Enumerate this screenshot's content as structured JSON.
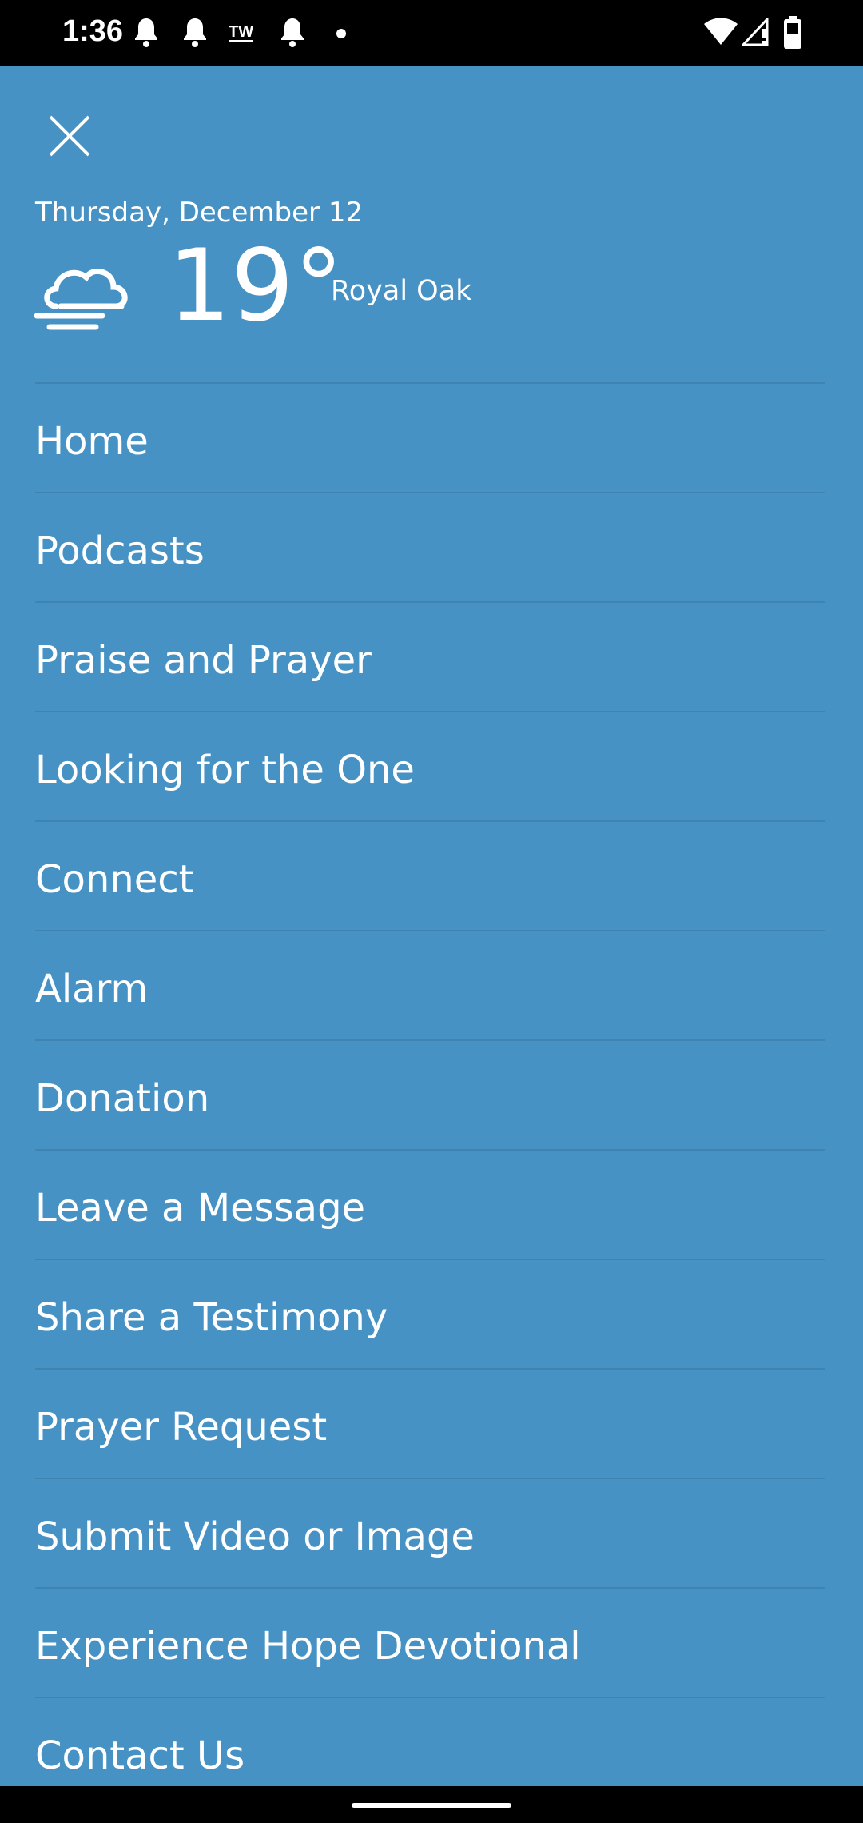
{
  "status_bar": {
    "time": "1:36",
    "icons": [
      "bell-icon",
      "bell-icon",
      "tw-icon",
      "bell-icon",
      "dot-icon",
      "wifi-icon",
      "signal-icon",
      "battery-icon"
    ],
    "tw_label": "TW"
  },
  "header": {
    "close_icon": "close-icon",
    "date": "Thursday, December 12",
    "weather_icon": "cloud-wind-icon",
    "temperature": "19°",
    "location": "Royal Oak"
  },
  "menu": {
    "items": [
      {
        "label": "Home"
      },
      {
        "label": "Podcasts"
      },
      {
        "label": "Praise and Prayer"
      },
      {
        "label": "Looking for the One"
      },
      {
        "label": "Connect"
      },
      {
        "label": "Alarm"
      },
      {
        "label": "Donation"
      },
      {
        "label": "Leave a Message"
      },
      {
        "label": "Share a Testimony"
      },
      {
        "label": "Prayer Request"
      },
      {
        "label": "Submit Video or Image"
      },
      {
        "label": "Experience Hope Devotional"
      },
      {
        "label": "Contact Us"
      }
    ]
  },
  "colors": {
    "background": "#4792c4",
    "divider": "#3f83b0",
    "text": "#ffffff",
    "system_bars": "#000000"
  }
}
